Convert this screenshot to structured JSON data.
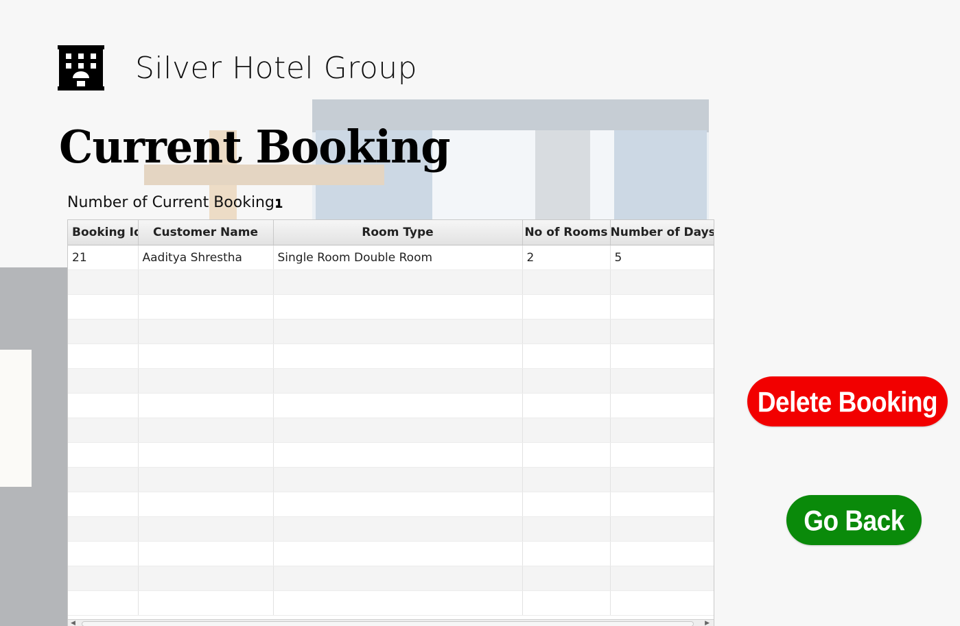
{
  "brand": {
    "name": "Silver Hotel Group",
    "logo_icon": "hotel-building-icon"
  },
  "page": {
    "title": "Current Booking",
    "count_label": "Number of Current Booking:",
    "count_value": "1"
  },
  "table": {
    "columns": [
      "Booking Id",
      "Customer Name",
      "Room Type",
      "No of Rooms",
      "Number of Days"
    ],
    "rows": [
      [
        "21",
        "Aaditya Shrestha",
        "Single Room Double Room",
        "2",
        "5"
      ]
    ],
    "empty_rows": 14
  },
  "actions": {
    "delete_label": "Delete Booking",
    "back_label": "Go Back"
  },
  "colors": {
    "delete": "#f20000",
    "back": "#0a8a0a"
  }
}
